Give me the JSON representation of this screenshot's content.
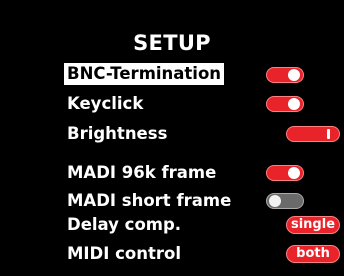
{
  "title": "SETUP",
  "items": [
    {
      "label": "BNC-Termination",
      "control": "toggle",
      "state": "on",
      "selected": true
    },
    {
      "label": "Keyclick",
      "control": "toggle",
      "state": "on",
      "selected": false
    },
    {
      "label": "Brightness",
      "control": "slider",
      "level": 0.85,
      "selected": false
    },
    {
      "label": "MADI 96k frame",
      "control": "toggle",
      "state": "on",
      "selected": false
    },
    {
      "label": "MADI short frame",
      "control": "toggle",
      "state": "off",
      "selected": false
    },
    {
      "label": "Delay comp.",
      "control": "option",
      "value": "single",
      "selected": false
    },
    {
      "label": "MIDI control",
      "control": "option",
      "value": "both",
      "selected": false
    }
  ],
  "colors": {
    "background": "#000000",
    "accent": "#e8232a",
    "toggle_off": "#6a6a6a",
    "text": "#ffffff"
  }
}
